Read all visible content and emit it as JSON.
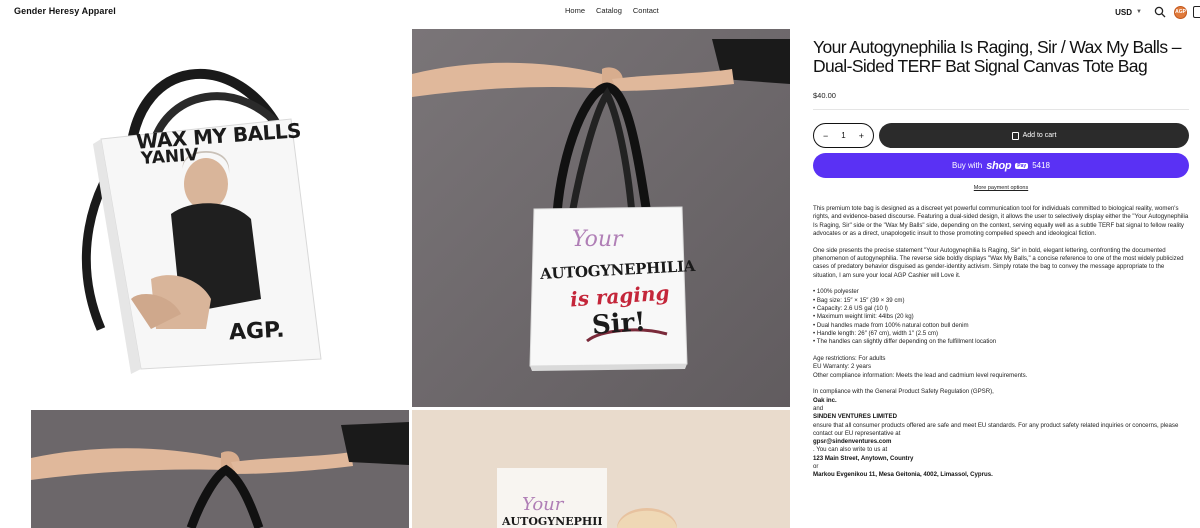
{
  "header": {
    "brand": "Gender Heresy Apparel",
    "nav": [
      "Home",
      "Catalog",
      "Contact"
    ],
    "currency": "USD",
    "avatar_text": "AGP"
  },
  "product": {
    "title": "Your Autogynephilia Is Raging, Sir / Wax My Balls – Dual-Sided TERF Bat Signal Canvas Tote Bag",
    "price": "$40.00",
    "quantity": "1",
    "add_to_cart": "Add to cart",
    "buy_with": "Buy with",
    "shop_logo": "shop",
    "shop_pay_badge": "Pay",
    "shop_number": "5418",
    "more_payment": "More payment options",
    "description_1": "This premium tote bag is designed as a discreet yet powerful communication tool for individuals committed to biological reality, women's rights, and evidence-based discourse. Featuring a dual-sided design, it allows the user to selectively display either the \"Your Autogynephilia Is Raging, Sir\" side or the \"Wax My Balls\" side, depending on the context, serving equally well as a subtle TERF bat signal to fellow reality advocates or as a direct, unapologetic insult to those promoting compelled speech and ideological fiction.",
    "description_2": "One side presents the precise statement \"Your Autogynephilia Is Raging, Sir\" in bold, elegant lettering, confronting the documented phenomenon of autogynephilia. The reverse side boldly displays \"Wax My Balls,\" a concise reference to one of the most widely publicized cases of predatory behavior disguised as gender-identity activism. Simply rotate the bag to convey the message appropriate to the situation, I am sure your local AGP Cashier will Love it.",
    "features": [
      "• 100% polyester",
      "• Bag size: 15″ × 15″ (39 × 39 cm)",
      "• Capacity: 2.6 US gal (10 l)",
      "• Maximum weight limit: 44lbs (20 kg)",
      "• Dual handles made from 100% natural cotton bull denim",
      "• Handle length: 26″ (67 cm), width 1″ (2.5 cm)",
      "• The handles can slightly differ depending on the fulfillment location"
    ],
    "compliance": [
      "Age restrictions: For adults",
      "EU Warranty: 2 years",
      "Other compliance information: Meets the lead and cadmium level requirements."
    ],
    "gpsr_intro": "In compliance with the General Product Safety Regulation (GPSR),",
    "gpsr_company_1": "Oak inc.",
    "gpsr_and": "and",
    "gpsr_company_2": "SINDEN VENTURES LIMITED",
    "gpsr_text": "ensure that all consumer products offered are safe and meet EU standards. For any product safety related inquiries or concerns, please contact our EU representative at",
    "gpsr_email": "gpsr@sindenventures.com",
    "gpsr_write": ". You can also write to us at",
    "gpsr_address_1": "123 Main Street, Anytown, Country",
    "gpsr_or": "or",
    "gpsr_address_2": "Markou Evgenikou 11, Mesa Geitonia, 4002, Limassol, Cyprus."
  },
  "images": {
    "side_a_line1": "WAX MY BALLS",
    "side_a_line2": "YANIV",
    "side_a_tag": "AGP.",
    "side_b_line1": "Your",
    "side_b_line2": "AUTOGYNEPHILIA",
    "side_b_line3": "is raging",
    "side_b_line4": "Sir!"
  },
  "colors": {
    "accent_shop": "#5a31f4",
    "button_dark": "#2b2b2b",
    "backdrop_gray": "#6f6a6d",
    "letter_purple": "#b07fb6",
    "letter_red": "#c4263a",
    "letter_gold": "#d7a441"
  }
}
